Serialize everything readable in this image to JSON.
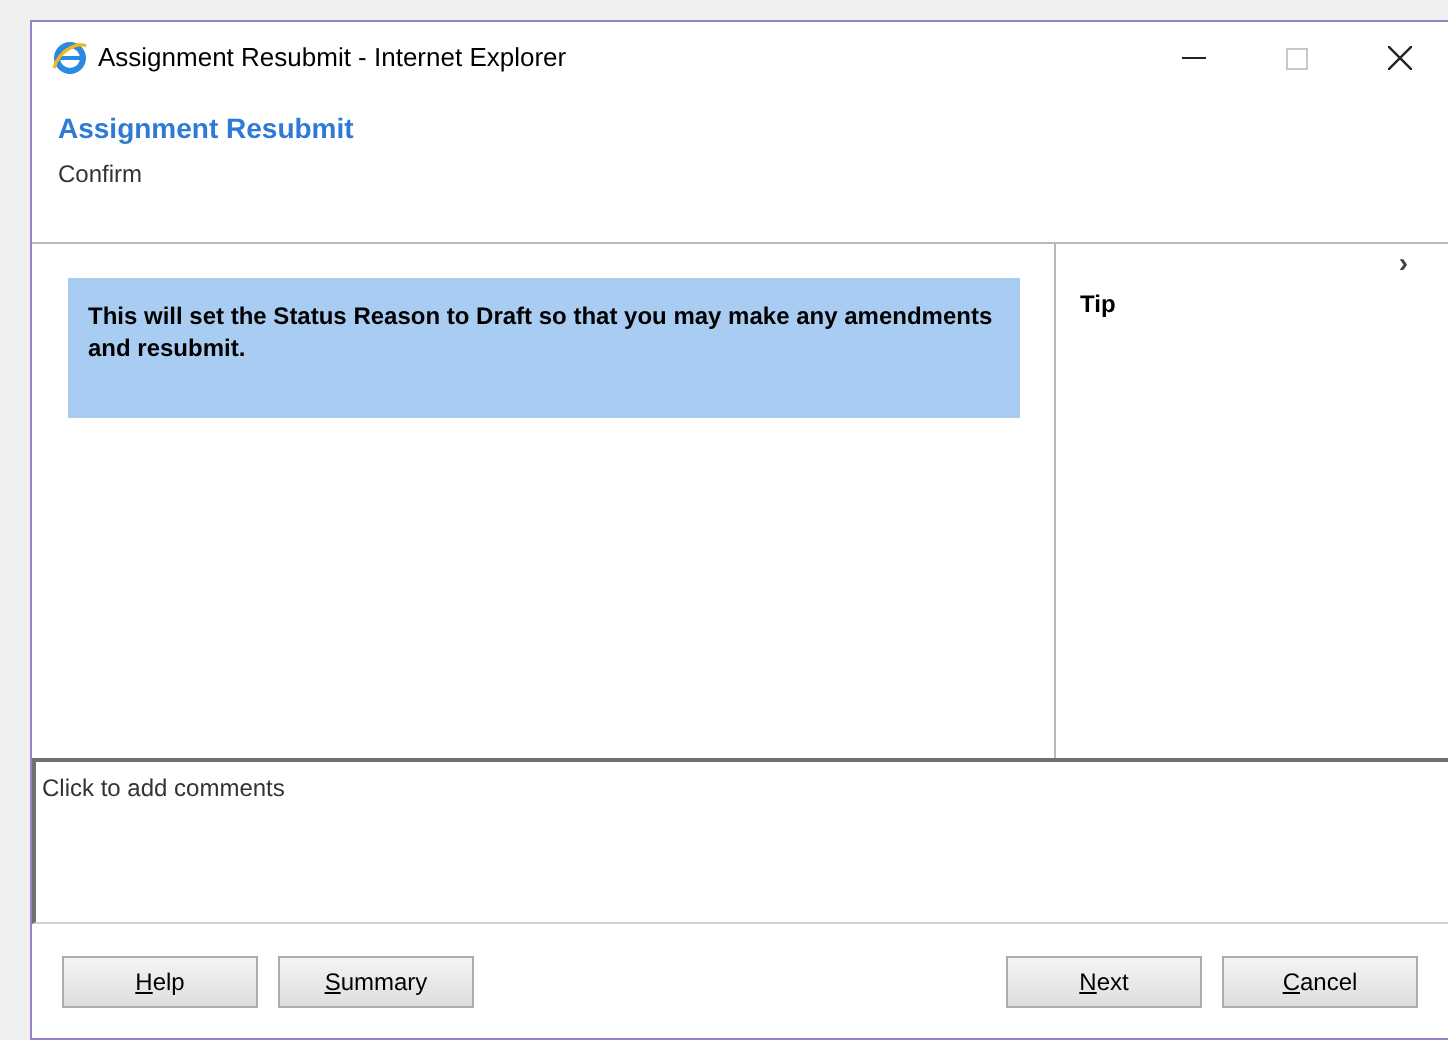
{
  "window": {
    "title": "Assignment Resubmit - Internet Explorer"
  },
  "header": {
    "title": "Assignment Resubmit",
    "subtitle": "Confirm"
  },
  "message": "This will set the Status Reason to Draft so that you may make any amendments and resubmit.",
  "tip_panel": {
    "title": "Tip",
    "toggle": "›"
  },
  "comments": {
    "placeholder": "Click to add comments"
  },
  "buttons_left": [
    {
      "label": "Help"
    },
    {
      "label": "Summary"
    }
  ],
  "buttons_right": [
    {
      "label": "Next"
    },
    {
      "label": "Cancel"
    }
  ]
}
